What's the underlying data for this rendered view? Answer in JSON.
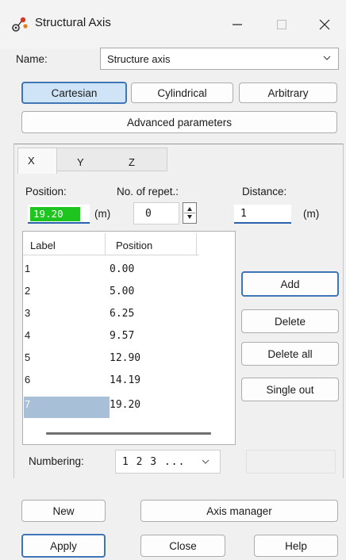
{
  "window": {
    "title": "Structural Axis"
  },
  "name_row": {
    "label": "Name:",
    "value": "Structure axis"
  },
  "axis_types": {
    "cartesian": "Cartesian",
    "cylindrical": "Cylindrical",
    "arbitrary": "Arbitrary",
    "selected": "Cartesian"
  },
  "advanced_label": "Advanced parameters",
  "tabs": [
    "X",
    "Y",
    "Z"
  ],
  "fields": {
    "position_label": "Position:",
    "position_value": "19.20",
    "position_unit": "(m)",
    "repet_label": "No. of repet.:",
    "repet_value": "0",
    "distance_label": "Distance:",
    "distance_value": "1",
    "distance_unit": "(m)"
  },
  "table": {
    "headers": [
      "Label",
      "Position"
    ],
    "rows": [
      {
        "label": "1",
        "position": "0.00"
      },
      {
        "label": "2",
        "position": "5.00"
      },
      {
        "label": "3",
        "position": "6.25"
      },
      {
        "label": "4",
        "position": "9.57"
      },
      {
        "label": "5",
        "position": "12.90"
      },
      {
        "label": "6",
        "position": "14.19"
      },
      {
        "label": "7",
        "position": "19.20"
      }
    ]
  },
  "side_buttons": {
    "add": "Add",
    "delete": "Delete",
    "delete_all": "Delete all",
    "single_out": "Single out"
  },
  "numbering": {
    "label": "Numbering:",
    "value": "1 2 3 ..."
  },
  "bottom": {
    "new": "New",
    "axis_manager": "Axis manager",
    "apply": "Apply",
    "close": "Close",
    "help": "Help"
  },
  "colors": {
    "accent": "#3f76b6",
    "selected_bg": "#cfe4f7",
    "position_highlight": "#1ec51e",
    "row_selected": "#a8bfd8"
  }
}
